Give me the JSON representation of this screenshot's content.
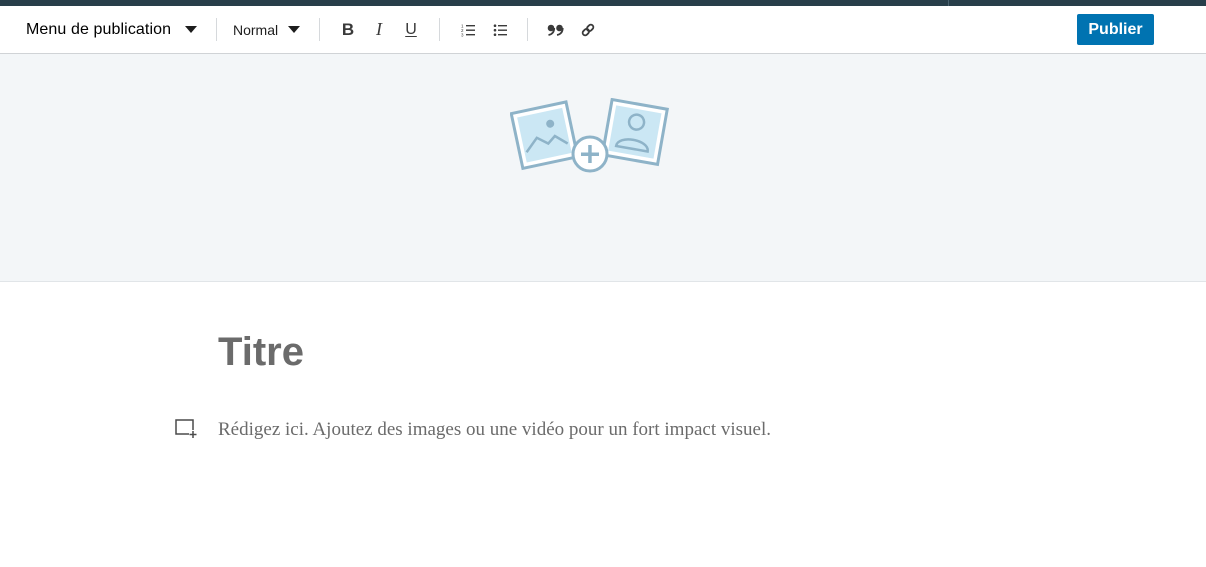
{
  "toolbar": {
    "menu_label": "Menu de publication",
    "style_label": "Normal",
    "bold_label": "B",
    "italic_label": "I",
    "underline_label": "U",
    "numbered_list_icon": "numbered-list-icon",
    "bullet_list_icon": "bullet-list-icon",
    "quote_icon": "quote-icon",
    "link_icon": "link-icon",
    "publish_label": "Publier"
  },
  "cover": {
    "icon": "add-images-icon"
  },
  "editor": {
    "title_placeholder": "Titre",
    "body_placeholder": "Rédigez ici. Ajoutez des images ou une vidéo pour un fort impact visuel.",
    "insert_icon": "insert-media-icon"
  },
  "colors": {
    "accent": "#0073b1",
    "top_bar": "#283e4a",
    "cover_background": "#f3f6f8",
    "placeholder_text": "#6b6b6b",
    "illustration_stroke": "#8eb3c8",
    "illustration_fill": "#cbe7f4"
  }
}
